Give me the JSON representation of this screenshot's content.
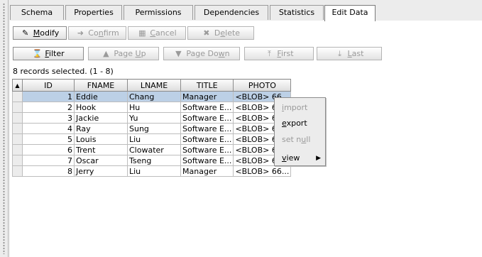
{
  "tabs": [
    {
      "label": "Schema",
      "selected": false
    },
    {
      "label": "Properties",
      "selected": false
    },
    {
      "label": "Permissions",
      "selected": false
    },
    {
      "label": "Dependencies",
      "selected": false
    },
    {
      "label": "Statistics",
      "selected": false
    },
    {
      "label": "Edit Data",
      "selected": true
    }
  ],
  "toolbar1": {
    "modify": {
      "pre": "",
      "mn": "M",
      "post": "odify",
      "icon": "edit-icon",
      "enabled": true
    },
    "confirm": {
      "pre": "Co",
      "mn": "n",
      "post": "firm",
      "icon": "confirm-icon",
      "enabled": false
    },
    "cancel": {
      "pre": "",
      "mn": "C",
      "post": "ancel",
      "icon": "cancel-icon",
      "enabled": false
    },
    "delete": {
      "pre": "D",
      "mn": "e",
      "post": "lete",
      "icon": "delete-icon",
      "enabled": false
    }
  },
  "toolbar2": {
    "filter": {
      "pre": "",
      "mn": "F",
      "post": "ilter",
      "icon": "filter-icon",
      "enabled": true
    },
    "page_up": {
      "pre": "Page ",
      "mn": "U",
      "post": "p",
      "icon": "page-up-icon",
      "enabled": false
    },
    "page_down": {
      "pre": "Page Do",
      "mn": "w",
      "post": "n",
      "icon": "page-down-icon",
      "enabled": false
    },
    "first": {
      "pre": "",
      "mn": "F",
      "post": "irst",
      "icon": "first-icon",
      "enabled": false
    },
    "last": {
      "pre": "",
      "mn": "L",
      "post": "ast",
      "icon": "last-icon",
      "enabled": false
    }
  },
  "status": "8 records selected. (1 - 8)",
  "table": {
    "columns": [
      "ID",
      "FNAME",
      "LNAME",
      "TITLE",
      "PHOTO"
    ],
    "sort_indicator": "▲",
    "rows": [
      {
        "id": "1",
        "fname": "Eddie",
        "lname": "Chang",
        "title": "Manager",
        "photo": "<BLOB> 66..."
      },
      {
        "id": "2",
        "fname": "Hook",
        "lname": "Hu",
        "title": "Software E...",
        "photo": "<BLOB> 66..."
      },
      {
        "id": "3",
        "fname": "Jackie",
        "lname": "Yu",
        "title": "Software E...",
        "photo": "<BLOB> 66..."
      },
      {
        "id": "4",
        "fname": "Ray",
        "lname": "Sung",
        "title": "Software E...",
        "photo": "<BLOB> 66..."
      },
      {
        "id": "5",
        "fname": "Louis",
        "lname": "Liu",
        "title": "Software E...",
        "photo": "<BLOB> 66..."
      },
      {
        "id": "6",
        "fname": "Trent",
        "lname": "Clowater",
        "title": "Software E...",
        "photo": "<BLOB> 66..."
      },
      {
        "id": "7",
        "fname": "Oscar",
        "lname": "Tseng",
        "title": "Software E...",
        "photo": "<BLOB> 66..."
      },
      {
        "id": "8",
        "fname": "Jerry",
        "lname": "Liu",
        "title": "Manager",
        "photo": "<BLOB> 66..."
      }
    ]
  },
  "context_menu": {
    "items": [
      {
        "pre": "",
        "mn": "i",
        "post": "mport",
        "enabled": false
      },
      {
        "pre": "",
        "mn": "e",
        "post": "xport",
        "enabled": true
      },
      {
        "pre": "set n",
        "mn": "u",
        "post": "ll",
        "enabled": false
      },
      {
        "pre": "",
        "mn": "v",
        "post": "iew",
        "enabled": true,
        "submenu": true,
        "arrow": "▶"
      }
    ]
  },
  "colors": {
    "selection": "#bcd0e6",
    "selected_tab": "#ffffff",
    "background": "#ececec"
  }
}
